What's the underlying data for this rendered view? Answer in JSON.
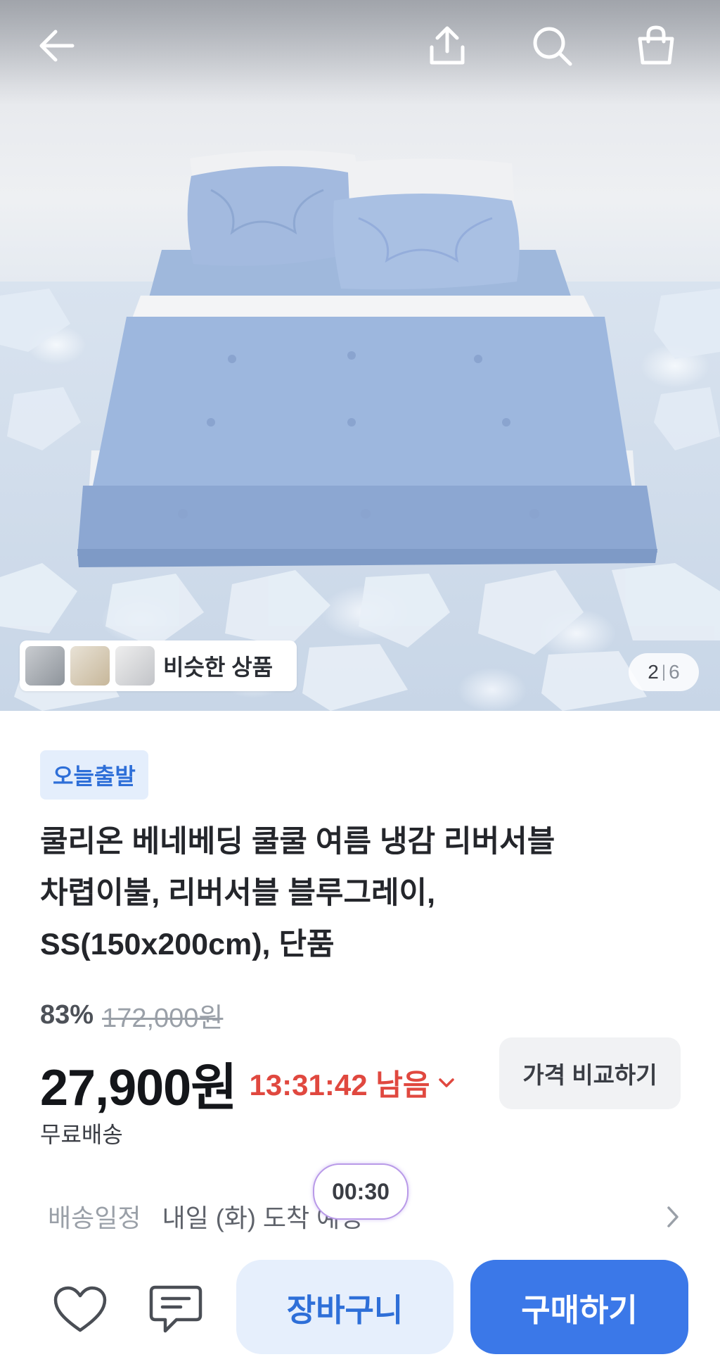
{
  "header": {
    "back_icon": "arrow-left-icon",
    "share_icon": "share-upload-icon",
    "search_icon": "search-icon",
    "cart_icon": "shopping-bag-icon"
  },
  "gallery": {
    "similar_label": "비슷한 상품",
    "current_page": "2",
    "total_pages": "6"
  },
  "product": {
    "badge": "오늘출발",
    "title_lines": [
      "쿨리온 베네베딩 쿨쿨 여름 냉감 리버서블",
      "차렵이불, 리버서블 블루그레이,",
      "SS(150x200cm), 단품"
    ],
    "discount": "83%",
    "original_price": "172,000원",
    "price": "27,900원",
    "timer": "13:31:42 남음",
    "compare_label": "가격 비교하기",
    "shipping": "무료배송"
  },
  "delivery": {
    "label": "배송일정",
    "value": "내일 (화) 도착 예정"
  },
  "floating_timer": "00:30",
  "bottom_bar": {
    "wishlist_icon": "heart-icon",
    "chat_icon": "chat-bubble-icon",
    "cart_label": "장바구니",
    "buy_label": "구매하기"
  },
  "colors": {
    "accent_blue": "#3b78e8",
    "timer_red": "#e0483f",
    "badge_bg": "#e4eefc"
  }
}
